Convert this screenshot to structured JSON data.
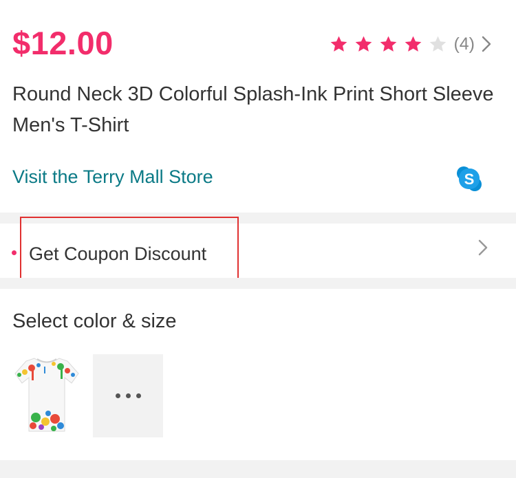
{
  "product": {
    "price": "$12.00",
    "rating": {
      "stars_filled": 4,
      "stars_total": 5,
      "review_count": "(4)",
      "star_color": "#f22d6b",
      "star_empty_color": "#e0e0e0"
    },
    "title": "Round Neck 3D Colorful Splash-Ink Print Short Sleeve Men's T-Shirt",
    "store_link": "Visit the Terry Mall Store",
    "chat_icon": "skype-icon"
  },
  "coupon": {
    "label": "Get Coupon Discount",
    "chevron_icon": "chevron-right-icon"
  },
  "variants": {
    "heading": "Select color & size",
    "more_icon": "more-horizontal-icon"
  },
  "colors": {
    "price": "#f22d6b",
    "store_link": "#0b7a86",
    "divider": "#f2f2f2",
    "highlight": "#e03030"
  }
}
